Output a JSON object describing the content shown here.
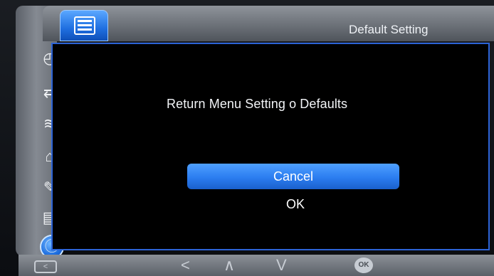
{
  "header": {
    "title": "Default Setting",
    "settings_tab_icon": "settings-list-icon"
  },
  "sidebar": {
    "items": [
      {
        "icon": "camera-mode-icon"
      },
      {
        "icon": "timezone-icon"
      },
      {
        "icon": "language-icon"
      },
      {
        "icon": "frequency-hz-icon"
      },
      {
        "icon": "usb-connection-icon"
      },
      {
        "icon": "microphone-icon"
      },
      {
        "icon": "sd-card-icon"
      },
      {
        "icon": "info-icon"
      }
    ]
  },
  "dialog": {
    "message": "Return Menu Setting  o Defaults",
    "cancel_label": "Cancel",
    "ok_label": "OK"
  },
  "bottom_bar": {
    "back_key": "<",
    "left_key": "<",
    "up_key": "∧",
    "down_key": "V",
    "ok_key": "OK"
  },
  "colors": {
    "accent_blue": "#2b7df0",
    "header_gray": "#7a7f86",
    "panel_black": "#000000"
  }
}
